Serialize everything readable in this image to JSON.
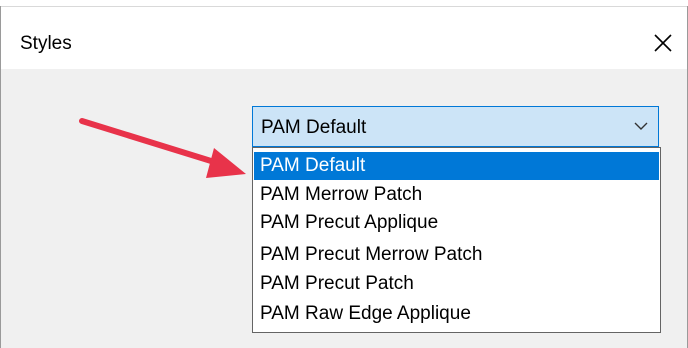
{
  "window": {
    "title": "Styles",
    "close_icon": "close-icon"
  },
  "style_select": {
    "value": "PAM Default",
    "options": [
      {
        "label": "PAM Default",
        "selected": true
      },
      {
        "label": "PAM Merrow Patch",
        "selected": false
      },
      {
        "label": "PAM Precut Applique",
        "selected": false
      },
      {
        "label": "PAM Precut Merrow Patch",
        "selected": false
      },
      {
        "label": "PAM Precut Patch",
        "selected": false
      },
      {
        "label": "PAM Raw Edge Applique",
        "selected": false
      }
    ]
  },
  "colors": {
    "accent": "#0078d7",
    "combo_focus_bg": "#cce4f7",
    "arrow": "#e8334a",
    "dialog_bg": "#f0f0f0"
  }
}
